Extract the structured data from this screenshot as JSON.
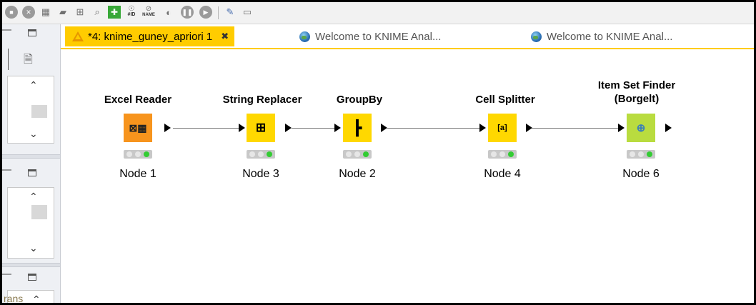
{
  "toolbar": {
    "icons": [
      "stop-icon",
      "cancel-all-icon",
      "layout-icon",
      "comment-icon",
      "zoom-icon",
      "search-icon",
      "add-node-icon",
      "show-node-id-icon",
      "hide-node-name-icon",
      "execute-icon",
      "pause-icon",
      "step-icon",
      "settings-icon",
      "panel-icon"
    ],
    "node_id_text": "#ID",
    "node_name_text": "NAME"
  },
  "left_panel": {
    "bottom_text": "rans"
  },
  "tabs": [
    {
      "label": "*4: knime_guney_apriori 1",
      "active": true
    },
    {
      "label": "Welcome to KNIME Anal...",
      "active": false
    },
    {
      "label": "Welcome to KNIME Anal...",
      "active": false
    }
  ],
  "workflow": {
    "nodes": [
      {
        "title": "Excel Reader",
        "label": "Node 1",
        "color": "#f7941d",
        "icon": "excel-reader-icon"
      },
      {
        "title": "String Replacer",
        "label": "Node 3",
        "color": "#ffd800",
        "icon": "string-replacer-icon"
      },
      {
        "title": "GroupBy",
        "label": "Node 2",
        "color": "#ffd800",
        "icon": "groupby-icon"
      },
      {
        "title": "Cell Splitter",
        "label": "Node 4",
        "color": "#ffd800",
        "icon": "cell-splitter-icon"
      },
      {
        "title_line1": "Item Set Finder",
        "title_line2": "(Borgelt)",
        "label": "Node 6",
        "color": "#b9dc3f",
        "icon": "item-set-finder-icon"
      }
    ],
    "status_colors": {
      "inactive": "#e6e6e6",
      "executed": "#33cc33"
    }
  }
}
